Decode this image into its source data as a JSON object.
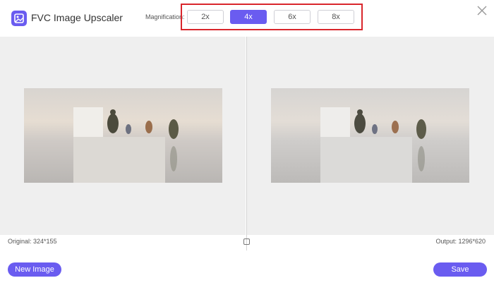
{
  "app": {
    "title": "FVC Image Upscaler"
  },
  "magnification": {
    "label": "Magnification:",
    "options": [
      {
        "label": "2x",
        "active": false
      },
      {
        "label": "4x",
        "active": true
      },
      {
        "label": "6x",
        "active": false
      },
      {
        "label": "8x",
        "active": false
      }
    ]
  },
  "preview": {
    "original_label": "Original: 324*155",
    "output_label": "Output: 1296*620"
  },
  "footer": {
    "new_image_label": "New Image",
    "save_label": "Save"
  },
  "colors": {
    "accent": "#6a5cf0",
    "highlight": "#d9262c",
    "panel_bg": "#efefef"
  }
}
